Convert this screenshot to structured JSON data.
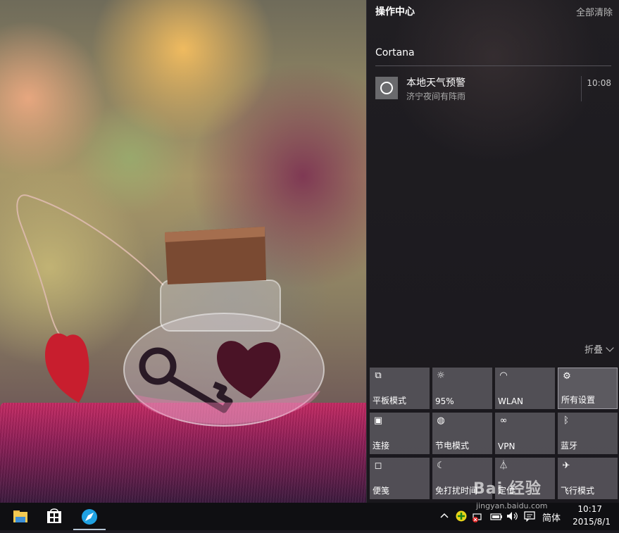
{
  "action_center": {
    "title": "操作中心",
    "clear_all": "全部清除",
    "group_name": "Cortana",
    "notification": {
      "icon": "cortana-circle-icon",
      "title": "本地天气预警",
      "body": "济宁夜间有阵雨",
      "time": "10:08"
    },
    "collapse_label": "折叠",
    "quick_actions": [
      {
        "label": "平板模式",
        "icon": "tablet-mode-icon",
        "glyph": "⧉",
        "active": false
      },
      {
        "label": "95%",
        "icon": "brightness-icon",
        "glyph": "☼",
        "active": false
      },
      {
        "label": "WLAN",
        "icon": "wifi-icon",
        "glyph": "◠",
        "active": false
      },
      {
        "label": "所有设置",
        "icon": "gear-icon",
        "glyph": "⚙",
        "active": true
      },
      {
        "label": "连接",
        "icon": "connect-icon",
        "glyph": "▣",
        "active": false
      },
      {
        "label": "节电模式",
        "icon": "battery-saver-icon",
        "glyph": "◍",
        "active": false
      },
      {
        "label": "VPN",
        "icon": "vpn-icon",
        "glyph": "∞",
        "active": false
      },
      {
        "label": "蓝牙",
        "icon": "bluetooth-icon",
        "glyph": "ᛒ",
        "active": false
      },
      {
        "label": "便笺",
        "icon": "note-icon",
        "glyph": "◻",
        "active": false
      },
      {
        "label": "免打扰时间",
        "icon": "moon-icon",
        "glyph": "☾",
        "active": false
      },
      {
        "label": "定位",
        "icon": "location-icon",
        "glyph": "⏃",
        "active": false
      },
      {
        "label": "飞行模式",
        "icon": "airplane-icon",
        "glyph": "✈",
        "active": false
      }
    ]
  },
  "taskbar": {
    "apps": [
      {
        "icon": "file-explorer-icon"
      },
      {
        "icon": "store-icon"
      },
      {
        "icon": "browser-icon"
      }
    ],
    "tray": {
      "ime": "简体",
      "time": "10:17",
      "date": "2015/8/1"
    }
  },
  "watermark": {
    "brand": "Bai 经验",
    "url": "jingyan.baidu.com"
  },
  "colors": {
    "taskbar": "#0f0f12",
    "tile": "#56545a",
    "accent_line": "#b7c7d6"
  }
}
